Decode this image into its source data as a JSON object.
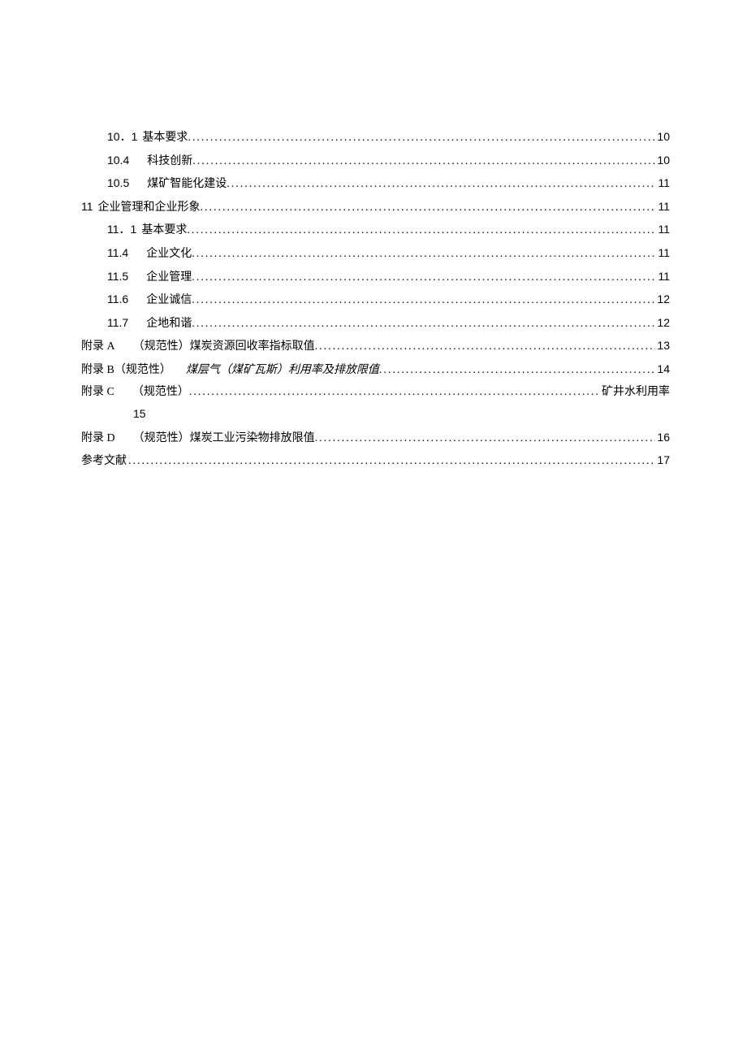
{
  "toc": {
    "items": [
      {
        "type": "sub",
        "number": "10．1",
        "title": "基本要求",
        "page": "10",
        "numGap": "2px",
        "titleGap": "4px"
      },
      {
        "type": "sub",
        "number": "10.4",
        "title": "科技创新",
        "page": "10",
        "numGap": "8px",
        "titleGap": "14px"
      },
      {
        "type": "sub",
        "number": "10.5",
        "title": "煤矿智能化建设",
        "page": "11",
        "numGap": "8px",
        "titleGap": "14px"
      },
      {
        "type": "section",
        "number": "11",
        "title": "企业管理和企业形象",
        "page": "11",
        "numGap": "2px",
        "titleGap": "4px"
      },
      {
        "type": "sub",
        "number": "11．1",
        "title": "基本要求",
        "page": "11",
        "numGap": "2px",
        "titleGap": "4px"
      },
      {
        "type": "sub",
        "number": "11.4",
        "title": "企业文化",
        "page": "11",
        "numGap": "8px",
        "titleGap": "14px"
      },
      {
        "type": "sub",
        "number": "11.5",
        "title": "企业管理",
        "page": "11",
        "numGap": "8px",
        "titleGap": "14px"
      },
      {
        "type": "sub",
        "number": "11.6",
        "title": "企业诚信",
        "page": "12",
        "numGap": "8px",
        "titleGap": "14px"
      },
      {
        "type": "sub",
        "number": "11.7",
        "title": "企地和谐",
        "page": "12",
        "numGap": "8px",
        "titleGap": "14px"
      },
      {
        "type": "section",
        "number": "附录 A",
        "title": "（规范性）煤炭资源回收率指标取值",
        "page": "13",
        "numGap": "0px",
        "titleGap": "22px"
      },
      {
        "type": "section",
        "number": "附录 B（规范性）",
        "title": "煤层气（煤矿瓦斯）利用率及排放限值",
        "page": "14",
        "numGap": "0px",
        "titleGap": "18px",
        "italicTitle": true
      },
      {
        "type": "appendix-c",
        "number": "附录 C",
        "title": "（规范性）",
        "trailing": "矿井水利用率",
        "subPage": "15",
        "numGap": "0px",
        "titleGap": "22px"
      },
      {
        "type": "section",
        "number": "附录 D",
        "title": "（规范性）煤炭工业污染物排放限值",
        "page": "16",
        "numGap": "0px",
        "titleGap": "22px"
      },
      {
        "type": "section",
        "number": "参考文献",
        "title": "",
        "page": "17",
        "numGap": "0px",
        "titleGap": "2px"
      }
    ]
  }
}
